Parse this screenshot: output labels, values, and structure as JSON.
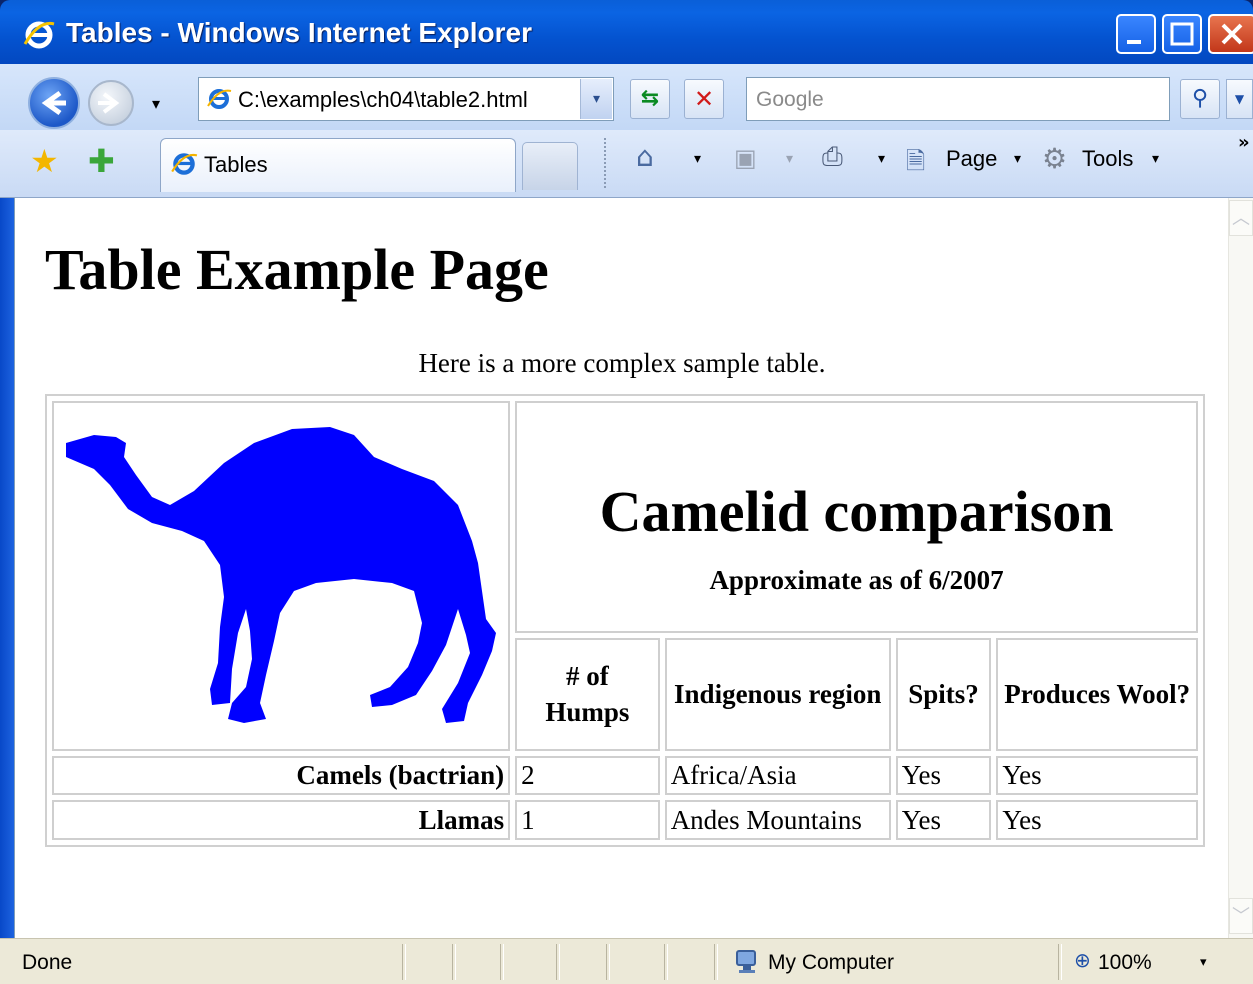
{
  "window": {
    "title": "Tables - Windows Internet Explorer"
  },
  "toolbar": {
    "address": "C:\\examples\\ch04\\table2.html",
    "search_placeholder": "Google",
    "nav_drop": "▾",
    "addr_drop": "▾",
    "go_icon": "go-arrows-icon",
    "stop_icon": "stop-x-icon",
    "search_icon": "magnifier-icon"
  },
  "tabs": [
    {
      "label": "Tables"
    }
  ],
  "commands": {
    "page_label": "Page",
    "tools_label": "Tools",
    "dropdown": "▾",
    "more": "»"
  },
  "page": {
    "heading": "Table Example Page",
    "intro": "Here is a more complex sample table.",
    "table": {
      "caption": "Camelid comparison",
      "subcaption": "Approximate as of 6/2007",
      "headers": [
        "# of Humps",
        "Indigenous region",
        "Spits?",
        "Produces Wool?"
      ],
      "rows": [
        {
          "name": "Camels (bactrian)",
          "cells": [
            "2",
            "Africa/Asia",
            "Yes",
            "Yes"
          ]
        },
        {
          "name": "Llamas",
          "cells": [
            "1",
            "Andes Mountains",
            "Yes",
            "Yes"
          ]
        }
      ],
      "image_color": "#0000ff"
    }
  },
  "status": {
    "text": "Done",
    "zone": "My Computer",
    "zoom": "100%",
    "zoom_drop": "▾"
  },
  "colors": {
    "titlebar": "#0453d0",
    "camel": "#0000ff"
  }
}
